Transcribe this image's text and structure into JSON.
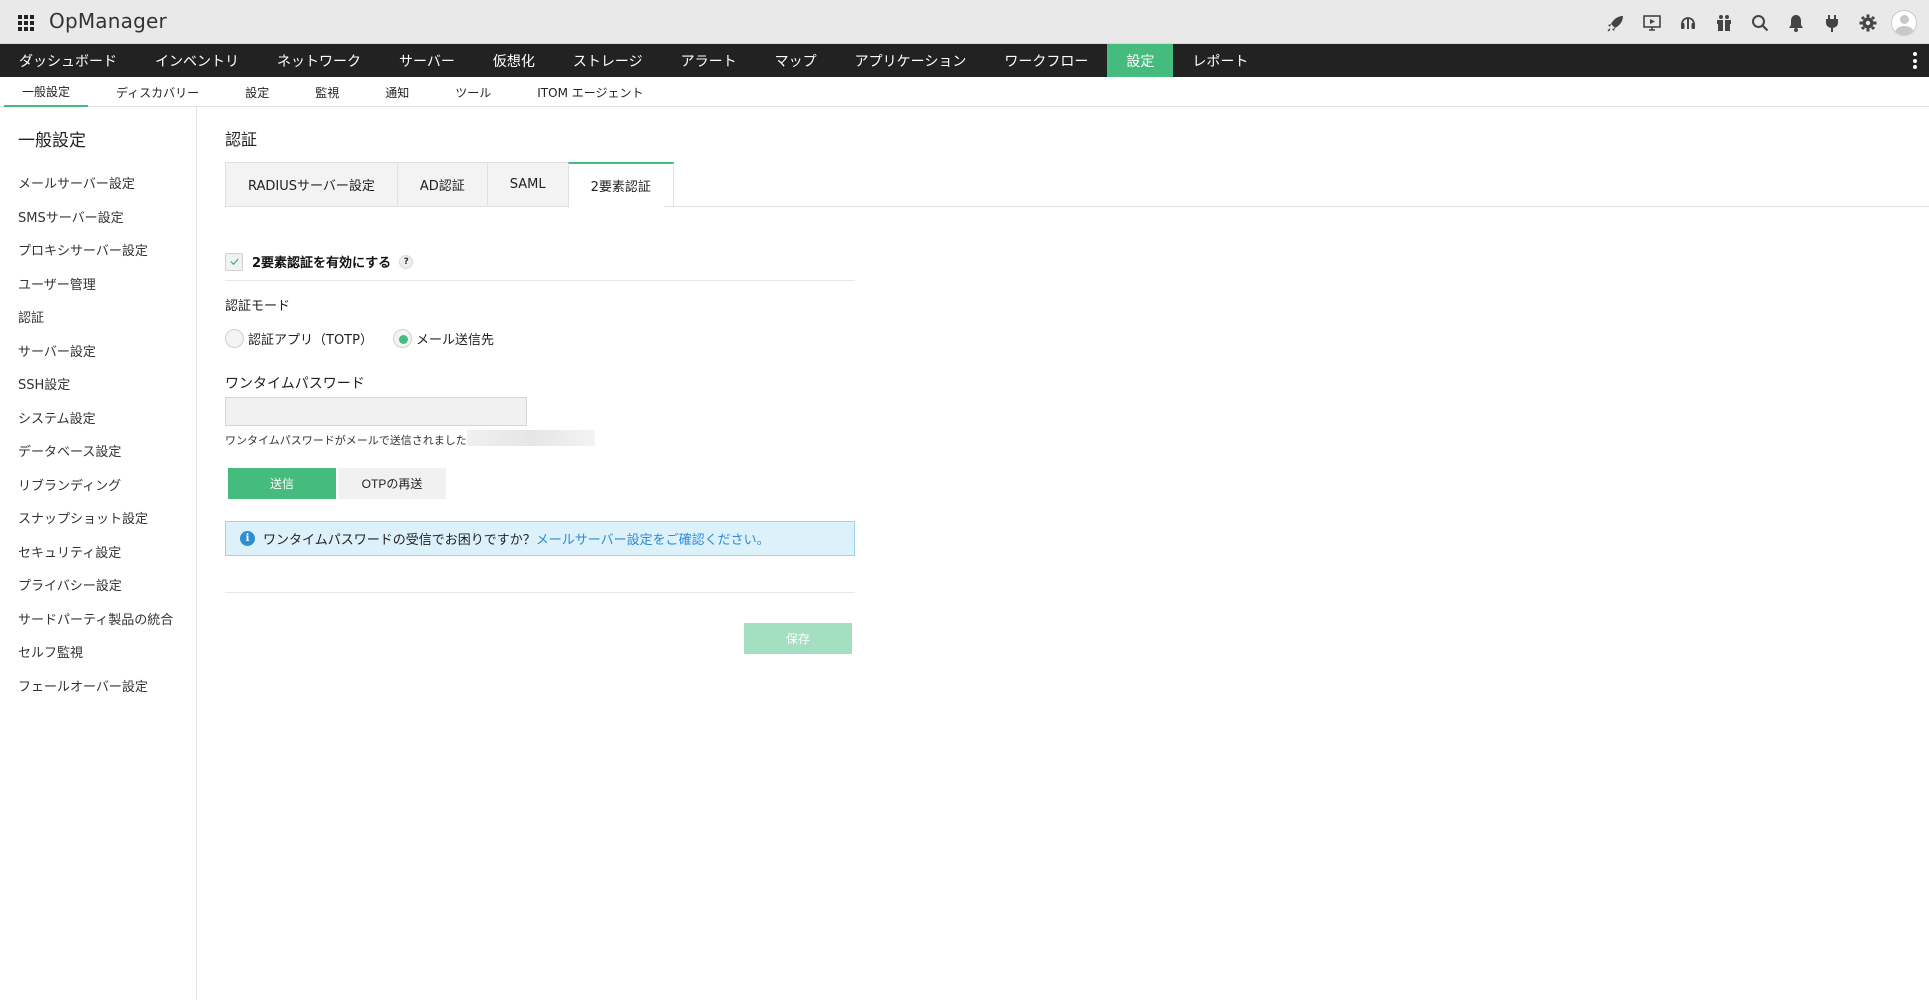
{
  "app": {
    "title": "OpManager"
  },
  "top_icons": [
    "rocket-icon",
    "presentation-icon",
    "headset-icon",
    "gift-icon",
    "search-icon",
    "bell-icon",
    "plug-icon",
    "gear-icon",
    "user-avatar"
  ],
  "main_nav": {
    "items": [
      {
        "label": "ダッシュボード"
      },
      {
        "label": "インベントリ"
      },
      {
        "label": "ネットワーク"
      },
      {
        "label": "サーバー"
      },
      {
        "label": "仮想化"
      },
      {
        "label": "ストレージ"
      },
      {
        "label": "アラート"
      },
      {
        "label": "マップ"
      },
      {
        "label": "アプリケーション"
      },
      {
        "label": "ワークフロー"
      },
      {
        "label": "設定"
      },
      {
        "label": "レポート"
      }
    ],
    "active": "設定"
  },
  "sub_nav": {
    "items": [
      {
        "label": "一般設定"
      },
      {
        "label": "ディスカバリー"
      },
      {
        "label": "設定"
      },
      {
        "label": "監視"
      },
      {
        "label": "通知"
      },
      {
        "label": "ツール"
      },
      {
        "label": "ITOM エージェント"
      }
    ],
    "active": "一般設定"
  },
  "sidebar": {
    "title": "一般設定",
    "items": [
      {
        "label": "メールサーバー設定"
      },
      {
        "label": "SMSサーバー設定"
      },
      {
        "label": "プロキシサーバー設定"
      },
      {
        "label": "ユーザー管理"
      },
      {
        "label": "認証"
      },
      {
        "label": "サーバー設定"
      },
      {
        "label": "SSH設定"
      },
      {
        "label": "システム設定"
      },
      {
        "label": "データベース設定"
      },
      {
        "label": "リブランディング"
      },
      {
        "label": "スナップショット設定"
      },
      {
        "label": "セキュリティ設定"
      },
      {
        "label": "プライバシー設定"
      },
      {
        "label": "サードパーティ製品の統合"
      },
      {
        "label": "セルフ監視"
      },
      {
        "label": "フェールオーバー設定"
      }
    ]
  },
  "content": {
    "title": "認証",
    "tabs": [
      {
        "label": "RADIUSサーバー設定"
      },
      {
        "label": "AD認証"
      },
      {
        "label": "SAML"
      },
      {
        "label": "2要素認証"
      }
    ],
    "active_tab": "2要素認証",
    "enable_label": "2要素認証を有効にする",
    "enable_checked": true,
    "help_symbol": "?",
    "mode_label": "認証モード",
    "modes": [
      {
        "label": "認証アプリ（TOTP）",
        "checked": false
      },
      {
        "label": "メール送信先",
        "checked": true
      }
    ],
    "otp_label": "ワンタイムパスワード",
    "otp_value": "",
    "otp_sent_text": "ワンタイムパスワードがメールで送信されました",
    "send_label": "送信",
    "resend_label": "OTPの再送",
    "info_text": "ワンタイムパスワードの受信でお困りですか？",
    "info_link": "メールサーバー設定をご確認ください。",
    "save_label": "保存"
  },
  "colors": {
    "accent": "#45bb7d",
    "nav_bg": "#222222",
    "info_bg": "#ddf1fb",
    "link": "#2c8bd6"
  }
}
